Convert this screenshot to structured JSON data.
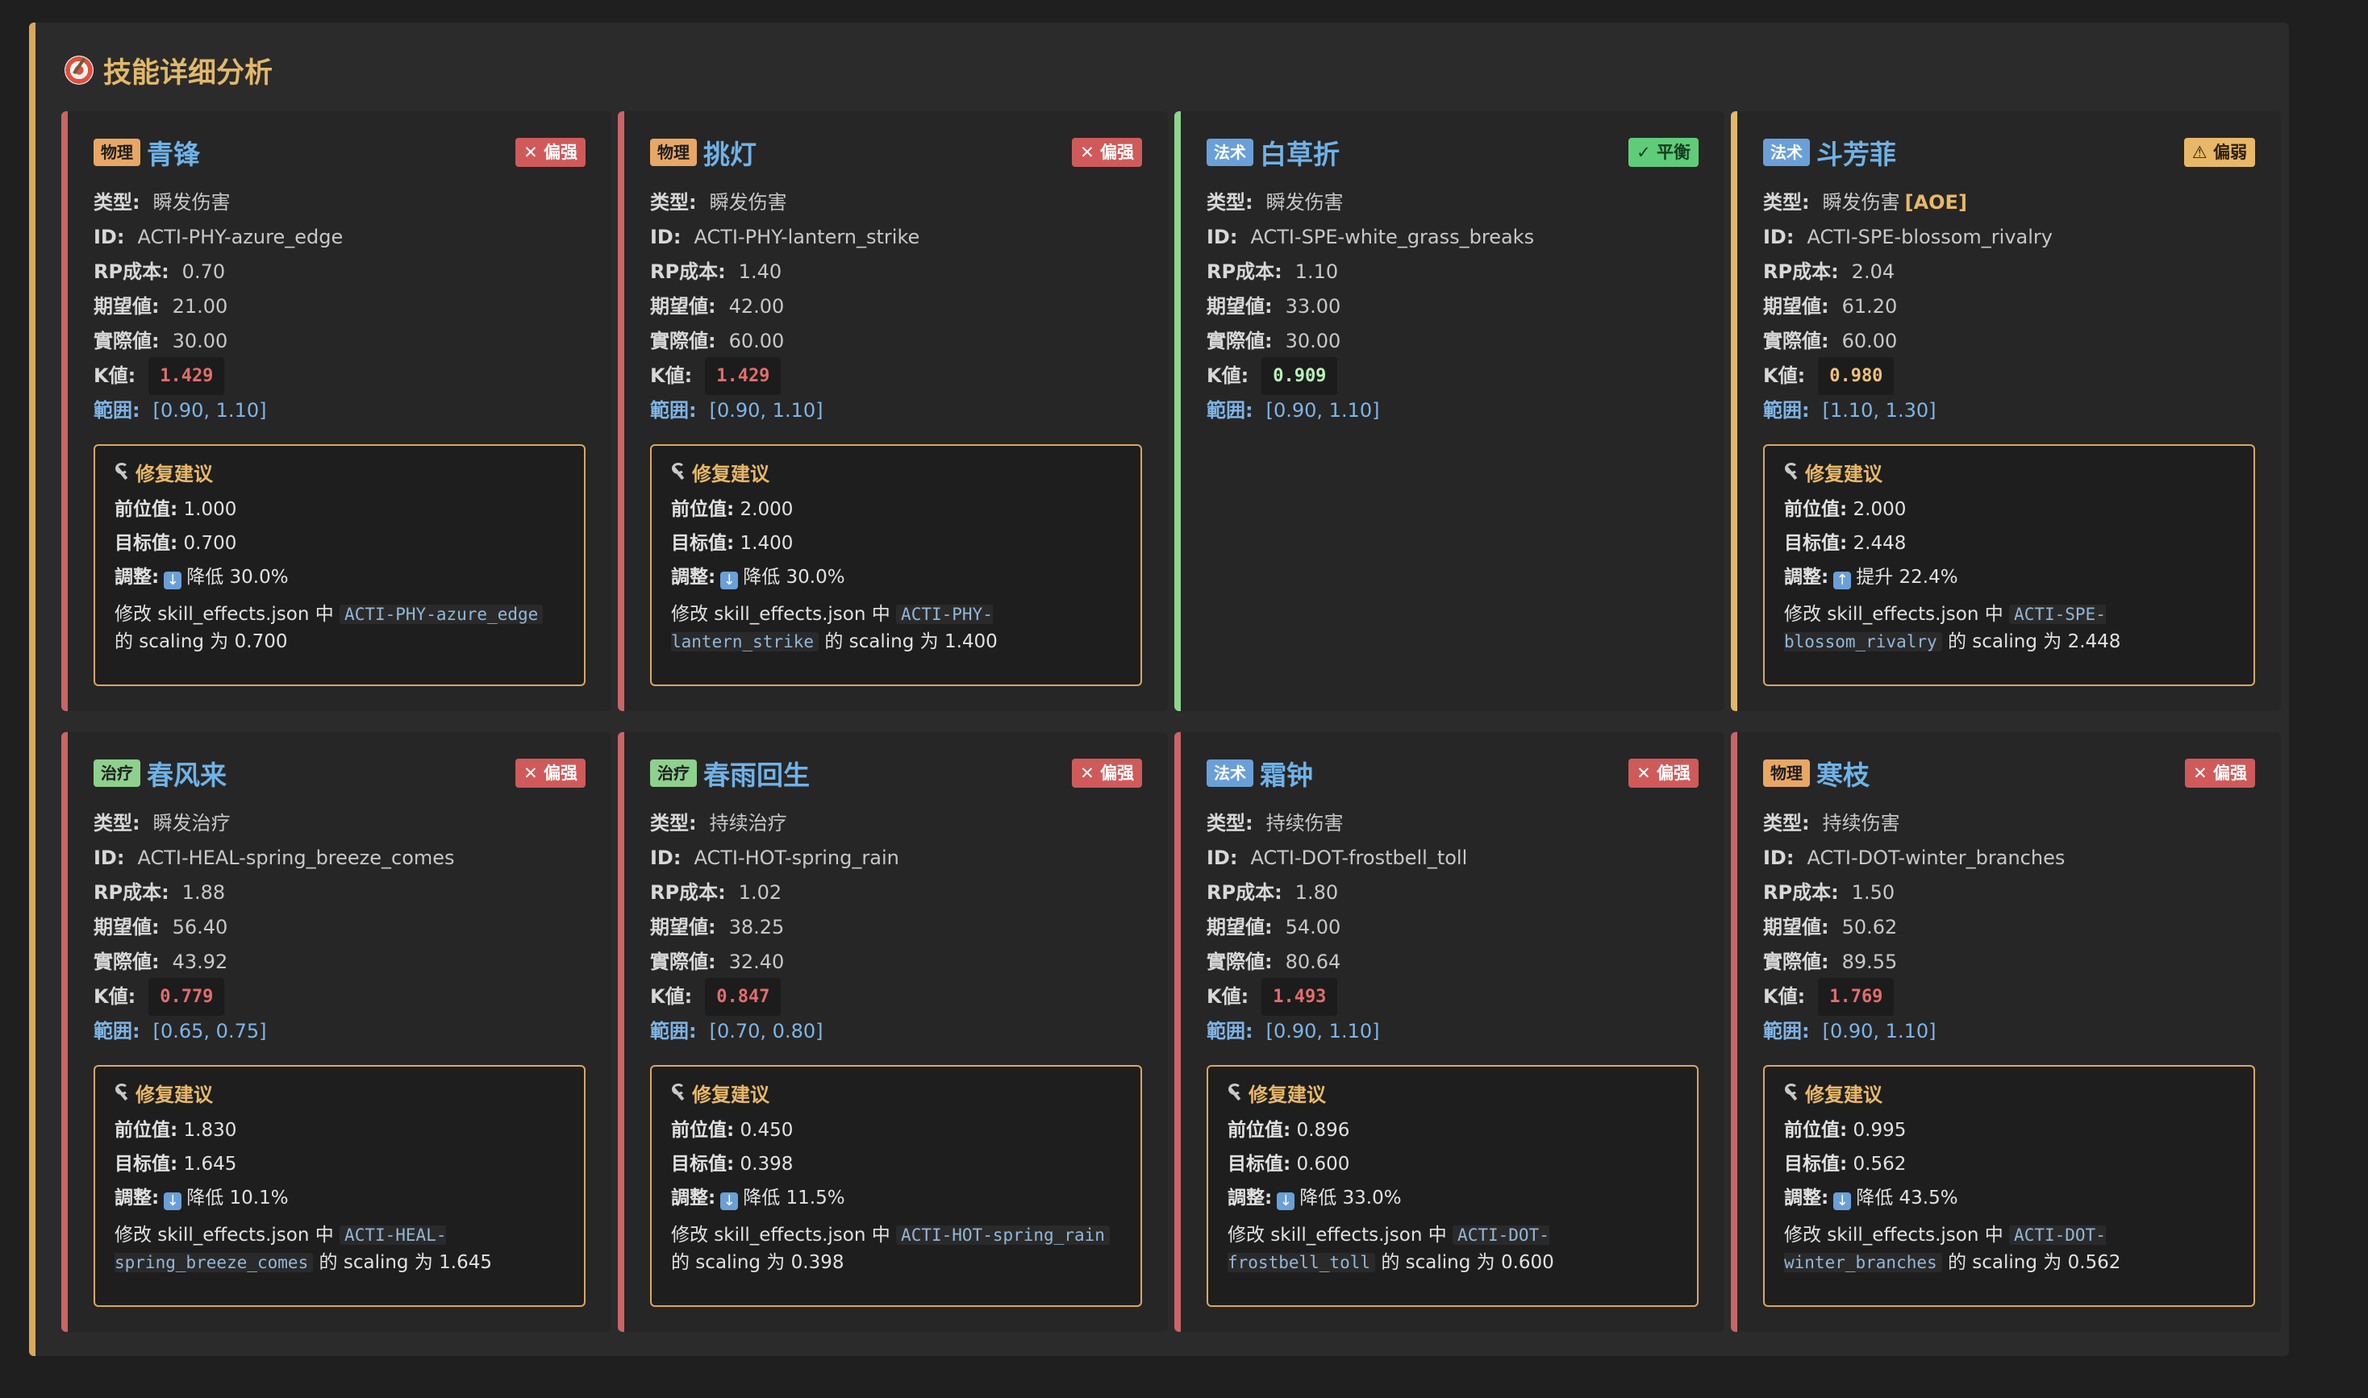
{
  "panel": {
    "title": "技能详细分析",
    "icon": "dart-target-icon"
  },
  "labels": {
    "type": "类型:",
    "id": "ID:",
    "rp": "RP成本:",
    "expected": "期望値:",
    "actual": "實際値:",
    "k": "K値:",
    "range": "範囲:",
    "fix_title": "修复建议",
    "prev": "前位值:",
    "target": "目标值:",
    "adjust": "調整:",
    "modify_prefix": "修改 skill_effects.json 中",
    "modify_mid": "的 scaling 为"
  },
  "cards": [
    {
      "tag": "物理",
      "tag_kind": "phy",
      "name": "青锋",
      "status": "偏强",
      "status_kind": "strong",
      "status_icon": "x-mark-icon",
      "type": "瞬发伤害",
      "aoe": "",
      "id": "ACTI-PHY-azure_edge",
      "rp": "0.70",
      "expected": "21.00",
      "actual": "30.00",
      "k": "1.429",
      "k_color": "red",
      "range": "[0.90, 1.10]",
      "fix": {
        "prev": "1.000",
        "target": "0.700",
        "dir": "降低",
        "pct": "30.0%",
        "scaling": "0.700",
        "code": "ACTI-PHY-azure_edge"
      }
    },
    {
      "tag": "物理",
      "tag_kind": "phy",
      "name": "挑灯",
      "status": "偏强",
      "status_kind": "strong",
      "status_icon": "x-mark-icon",
      "type": "瞬发伤害",
      "aoe": "",
      "id": "ACTI-PHY-lantern_strike",
      "rp": "1.40",
      "expected": "42.00",
      "actual": "60.00",
      "k": "1.429",
      "k_color": "red",
      "range": "[0.90, 1.10]",
      "fix": {
        "prev": "2.000",
        "target": "1.400",
        "dir": "降低",
        "pct": "30.0%",
        "scaling": "1.400",
        "code": "ACTI-PHY-lantern_strike"
      }
    },
    {
      "tag": "法术",
      "tag_kind": "spe",
      "name": "白草折",
      "status": "平衡",
      "status_kind": "ok",
      "status_icon": "check-box-icon",
      "type": "瞬发伤害",
      "aoe": "",
      "id": "ACTI-SPE-white_grass_breaks",
      "rp": "1.10",
      "expected": "33.00",
      "actual": "30.00",
      "k": "0.909",
      "k_color": "green",
      "range": "[0.90, 1.10]",
      "fix": null
    },
    {
      "tag": "法术",
      "tag_kind": "spe",
      "name": "斗芳菲",
      "status": "偏弱",
      "status_kind": "weak",
      "status_icon": "warning-icon",
      "type": "瞬发伤害",
      "aoe": "[AOE]",
      "id": "ACTI-SPE-blossom_rivalry",
      "rp": "2.04",
      "expected": "61.20",
      "actual": "60.00",
      "k": "0.980",
      "k_color": "orange",
      "range": "[1.10, 1.30]",
      "fix": {
        "prev": "2.000",
        "target": "2.448",
        "dir": "提升",
        "pct": "22.4%",
        "scaling": "2.448",
        "code": "ACTI-SPE-blossom_rivalry"
      }
    },
    {
      "tag": "治疗",
      "tag_kind": "heal",
      "name": "春风来",
      "status": "偏强",
      "status_kind": "strong",
      "status_icon": "x-mark-icon",
      "type": "瞬发治疗",
      "aoe": "",
      "id": "ACTI-HEAL-spring_breeze_comes",
      "rp": "1.88",
      "expected": "56.40",
      "actual": "43.92",
      "k": "0.779",
      "k_color": "red",
      "range": "[0.65, 0.75]",
      "fix": {
        "prev": "1.830",
        "target": "1.645",
        "dir": "降低",
        "pct": "10.1%",
        "scaling": "1.645",
        "code": "ACTI-HEAL-spring_breeze_comes"
      }
    },
    {
      "tag": "治疗",
      "tag_kind": "heal",
      "name": "春雨回生",
      "status": "偏强",
      "status_kind": "strong",
      "status_icon": "x-mark-icon",
      "type": "持续治疗",
      "aoe": "",
      "id": "ACTI-HOT-spring_rain",
      "rp": "1.02",
      "expected": "38.25",
      "actual": "32.40",
      "k": "0.847",
      "k_color": "red",
      "range": "[0.70, 0.80]",
      "fix": {
        "prev": "0.450",
        "target": "0.398",
        "dir": "降低",
        "pct": "11.5%",
        "scaling": "0.398",
        "code": "ACTI-HOT-spring_rain"
      }
    },
    {
      "tag": "法术",
      "tag_kind": "spe",
      "name": "霜钟",
      "status": "偏强",
      "status_kind": "strong",
      "status_icon": "x-mark-icon",
      "type": "持续伤害",
      "aoe": "",
      "id": "ACTI-DOT-frostbell_toll",
      "rp": "1.80",
      "expected": "54.00",
      "actual": "80.64",
      "k": "1.493",
      "k_color": "red",
      "range": "[0.90, 1.10]",
      "fix": {
        "prev": "0.896",
        "target": "0.600",
        "dir": "降低",
        "pct": "33.0%",
        "scaling": "0.600",
        "code": "ACTI-DOT-frostbell_toll"
      }
    },
    {
      "tag": "物理",
      "tag_kind": "phy",
      "name": "寒枝",
      "status": "偏强",
      "status_kind": "strong",
      "status_icon": "x-mark-icon",
      "type": "持续伤害",
      "aoe": "",
      "id": "ACTI-DOT-winter_branches",
      "rp": "1.50",
      "expected": "50.62",
      "actual": "89.55",
      "k": "1.769",
      "k_color": "red",
      "range": "[0.90, 1.10]",
      "fix": {
        "prev": "0.995",
        "target": "0.562",
        "dir": "降低",
        "pct": "43.5%",
        "scaling": "0.562",
        "code": "ACTI-DOT-winter_branches"
      }
    }
  ]
}
